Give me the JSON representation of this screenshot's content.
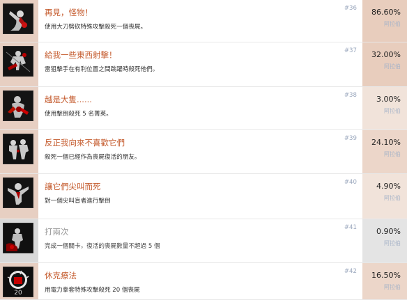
{
  "achievements": [
    {
      "title": "再見，怪物！",
      "desc": "使用大刀劈砍特殊攻擊殺死一個喪屍。",
      "number": "#36",
      "percent": "86.60%",
      "sub": "阿拉伯",
      "icon": "cleaver-zombie-icon",
      "title_color": "#c45a2c",
      "icon_bg": "#e7cfc2",
      "pct_bg": "#e8cdbd",
      "muted": false
    },
    {
      "title": "給我一些東西射擊！",
      "desc": "雷狙擊手在有利位置之間跳躍時殺死他們。",
      "number": "#37",
      "percent": "32.00%",
      "sub": "阿拉伯",
      "icon": "sniper-target-icon",
      "title_color": "#c45a2c",
      "icon_bg": "#e7cfc2",
      "pct_bg": "#e8cdbd",
      "muted": false
    },
    {
      "title": "越是大隻......",
      "desc": "使用擊倒殺死 5 名菁英。",
      "number": "#38",
      "percent": "3.00%",
      "sub": "阿拉伯",
      "icon": "elite-kill-icon",
      "title_color": "#c45a2c",
      "icon_bg": "#e7cfc2",
      "pct_bg": "#f1e3da",
      "muted": false
    },
    {
      "title": "反正我向來不喜歡它們",
      "desc": "殺死一個已經作為喪屍復活的朋友。",
      "number": "#39",
      "percent": "24.10%",
      "sub": "阿拉伯",
      "icon": "zombified-friend-icon",
      "title_color": "#c45a2c",
      "icon_bg": "#e7cfc2",
      "pct_bg": "#ecd6c9",
      "muted": false
    },
    {
      "title": "讓它們尖叫而死",
      "desc": "對一個尖叫盲者進行擊倒",
      "number": "#40",
      "percent": "4.90%",
      "sub": "阿拉伯",
      "icon": "screamer-icon",
      "title_color": "#c45a2c",
      "icon_bg": "#e7cfc2",
      "pct_bg": "#f1e3da",
      "muted": false
    },
    {
      "title": "打兩次",
      "desc": "完成一個關卡，復活的喪屍數量不超過 5 個",
      "number": "#41",
      "percent": "0.90%",
      "sub": "阿拉伯",
      "icon": "double-tap-icon",
      "title_color": "#9a9a9a",
      "icon_bg": "#d9d9d9",
      "pct_bg": "#e4e4e4",
      "muted": true
    },
    {
      "title": "休克療法",
      "desc": "用電力拳套特殊攻擊殺死 20 個喪屍",
      "number": "#42",
      "percent": "16.50%",
      "sub": "阿拉伯",
      "icon": "shock-fist-icon",
      "title_color": "#c45a2c",
      "icon_bg": "#e7cfc2",
      "pct_bg": "#ecd6c9",
      "muted": false
    }
  ]
}
